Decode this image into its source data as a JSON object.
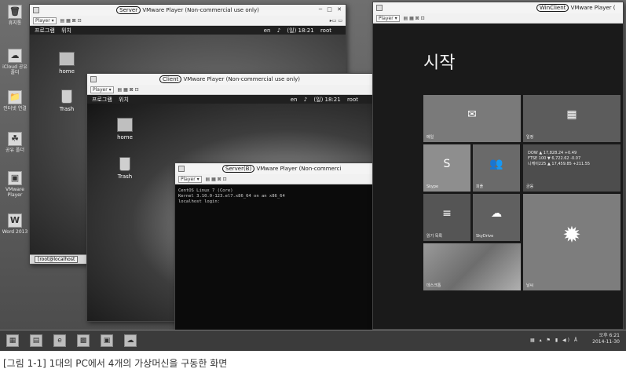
{
  "host": {
    "desktop_icons": [
      {
        "label": "휴지통",
        "glyph": "🗑"
      },
      {
        "label": "iCloud 공유 폴더",
        "glyph": "☁"
      },
      {
        "label": "인터넷 연결",
        "glyph": "📁"
      },
      {
        "label": "공유 폴더",
        "glyph": "☘"
      },
      {
        "label": "VMware Player",
        "glyph": "▣"
      },
      {
        "label": "Word 2013",
        "glyph": "W"
      }
    ],
    "tray": {
      "time": "오후 6:21",
      "date": "2014-11-30"
    },
    "taskbar_items": [
      "▦",
      "▤",
      "e",
      "▩",
      "▣",
      "☁"
    ]
  },
  "windows": {
    "server": {
      "name": "Server",
      "title_suffix": "VMware Player (Non-commercial use only)",
      "player_label": "Player ▾",
      "menu": [
        "프로그램",
        "위치"
      ],
      "status": {
        "lang": "en",
        "date": "(일) 18:21",
        "user": "root"
      },
      "desktop_icons": [
        "home",
        "Trash"
      ],
      "taskbar_item": "[root@localhost"
    },
    "client": {
      "name": "Client",
      "title_suffix": "VMware Player (Non-commercial use only)",
      "player_label": "Player ▾",
      "menu": [
        "프로그램",
        "위치"
      ],
      "status": {
        "lang": "en",
        "date": "(일) 18:21",
        "user": "root"
      },
      "desktop_icons": [
        "home",
        "Trash"
      ]
    },
    "serverb": {
      "name": "Server(B)",
      "title_suffix": "VMware Player (Non-commerci",
      "player_label": "Player ▾",
      "terminal": [
        "CentOS Linux 7 (Core)",
        "Kernel 3.10.0-123.el7.x86_64 on an x86_64",
        "",
        "localhost login:"
      ]
    },
    "winclient": {
      "name": "WinClient",
      "title_suffix": "VMware Player (",
      "player_label": "Player ▾",
      "start_label": "시작",
      "tiles": [
        {
          "label": "메일",
          "icon": "✉"
        },
        {
          "label": "일정",
          "icon": "▦"
        },
        {
          "label": "Skype",
          "icon": "S"
        },
        {
          "label": "피플",
          "icon": "👥"
        },
        {
          "label": "금융",
          "icon": ""
        },
        {
          "label": "읽기 목록",
          "icon": "≡"
        },
        {
          "label": "SkyDrive",
          "icon": "☁"
        },
        {
          "label": "날씨",
          "icon": "✹"
        },
        {
          "label": "데스크톱",
          "icon": ""
        }
      ],
      "finance": [
        {
          "name": "DOW",
          "value": "▲ 17,828.24 +0.49"
        },
        {
          "name": "FTSE 100",
          "value": "▼ 6,722.62 -0.07"
        },
        {
          "name": "니케이225",
          "value": "▲ 17,459.85 +211.55"
        }
      ]
    }
  },
  "caption": "[그림 1-1] 1대의 PC에서 4개의 가상머신을 구동한 화면"
}
